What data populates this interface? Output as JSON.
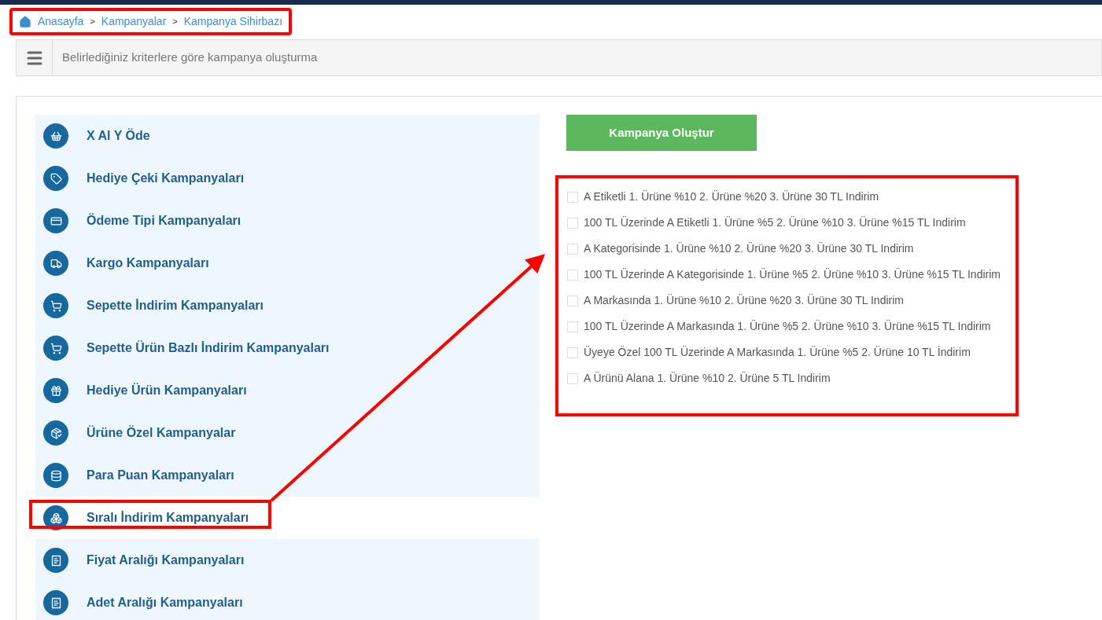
{
  "breadcrumb": [
    {
      "label": "Anasayfa",
      "kind": "home"
    },
    {
      "label": "Kampanyalar",
      "kind": "link"
    },
    {
      "label": "Kampanya Sihirbazı",
      "kind": "link"
    }
  ],
  "breadcrumb_separator": ">",
  "header": {
    "title": "Belirlediğiniz kriterlere göre kampanya oluşturma"
  },
  "sidebar": {
    "items": [
      {
        "label": "X Al Y Öde",
        "selected": false
      },
      {
        "label": "Hediye Çeki Kampanyaları",
        "selected": false
      },
      {
        "label": "Ödeme Tipi Kampanyaları",
        "selected": false
      },
      {
        "label": "Kargo Kampanyaları",
        "selected": false
      },
      {
        "label": "Sepette İndirim Kampanyaları",
        "selected": false
      },
      {
        "label": "Sepette Ürün Bazlı İndirim Kampanyaları",
        "selected": false
      },
      {
        "label": "Hediye Ürün Kampanyaları",
        "selected": false
      },
      {
        "label": "Ürüne Özel Kampanyalar",
        "selected": false
      },
      {
        "label": "Para Puan Kampanyaları",
        "selected": false
      },
      {
        "label": "Sıralı İndirim Kampanyaları",
        "selected": true
      },
      {
        "label": "Fiyat Aralığı Kampanyaları",
        "selected": false
      },
      {
        "label": "Adet Aralığı Kampanyaları",
        "selected": false
      }
    ]
  },
  "create_button": {
    "label": "Kampanya Oluştur"
  },
  "options": [
    {
      "label": "A Etiketli 1. Ürüne %10 2. Ürüne %20 3. Ürüne 30 TL Indirim",
      "checked": false
    },
    {
      "label": "100 TL Üzerinde A Etiketli 1. Ürüne %5 2. Ürüne %10 3. Ürüne %15 TL Indirim",
      "checked": false
    },
    {
      "label": "A Kategorisinde 1. Ürüne %10 2. Ürüne %20 3. Ürüne 30 TL Indirim",
      "checked": false
    },
    {
      "label": "100 TL Üzerinde A Kategorisinde 1. Ürüne %5 2. Ürüne %10 3. Ürüne %15 TL Indirim",
      "checked": false
    },
    {
      "label": "A Markasında 1. Ürüne %10 2. Ürüne %20 3. Ürüne 30 TL Indirim",
      "checked": false
    },
    {
      "label": "100 TL Üzerinde A Markasında 1. Ürüne %5 2. Ürüne %10 3. Ürüne %15 TL Indirim",
      "checked": false
    },
    {
      "label": "Üyeye Özel 100 TL Üzerinde A Markasında 1. Ürüne %5 2. Ürüne 10 TL İndirim",
      "checked": false
    },
    {
      "label": "A Ürünü Alana 1. Ürüne %10 2. Ürüne 5 TL Indirim",
      "checked": false
    }
  ]
}
